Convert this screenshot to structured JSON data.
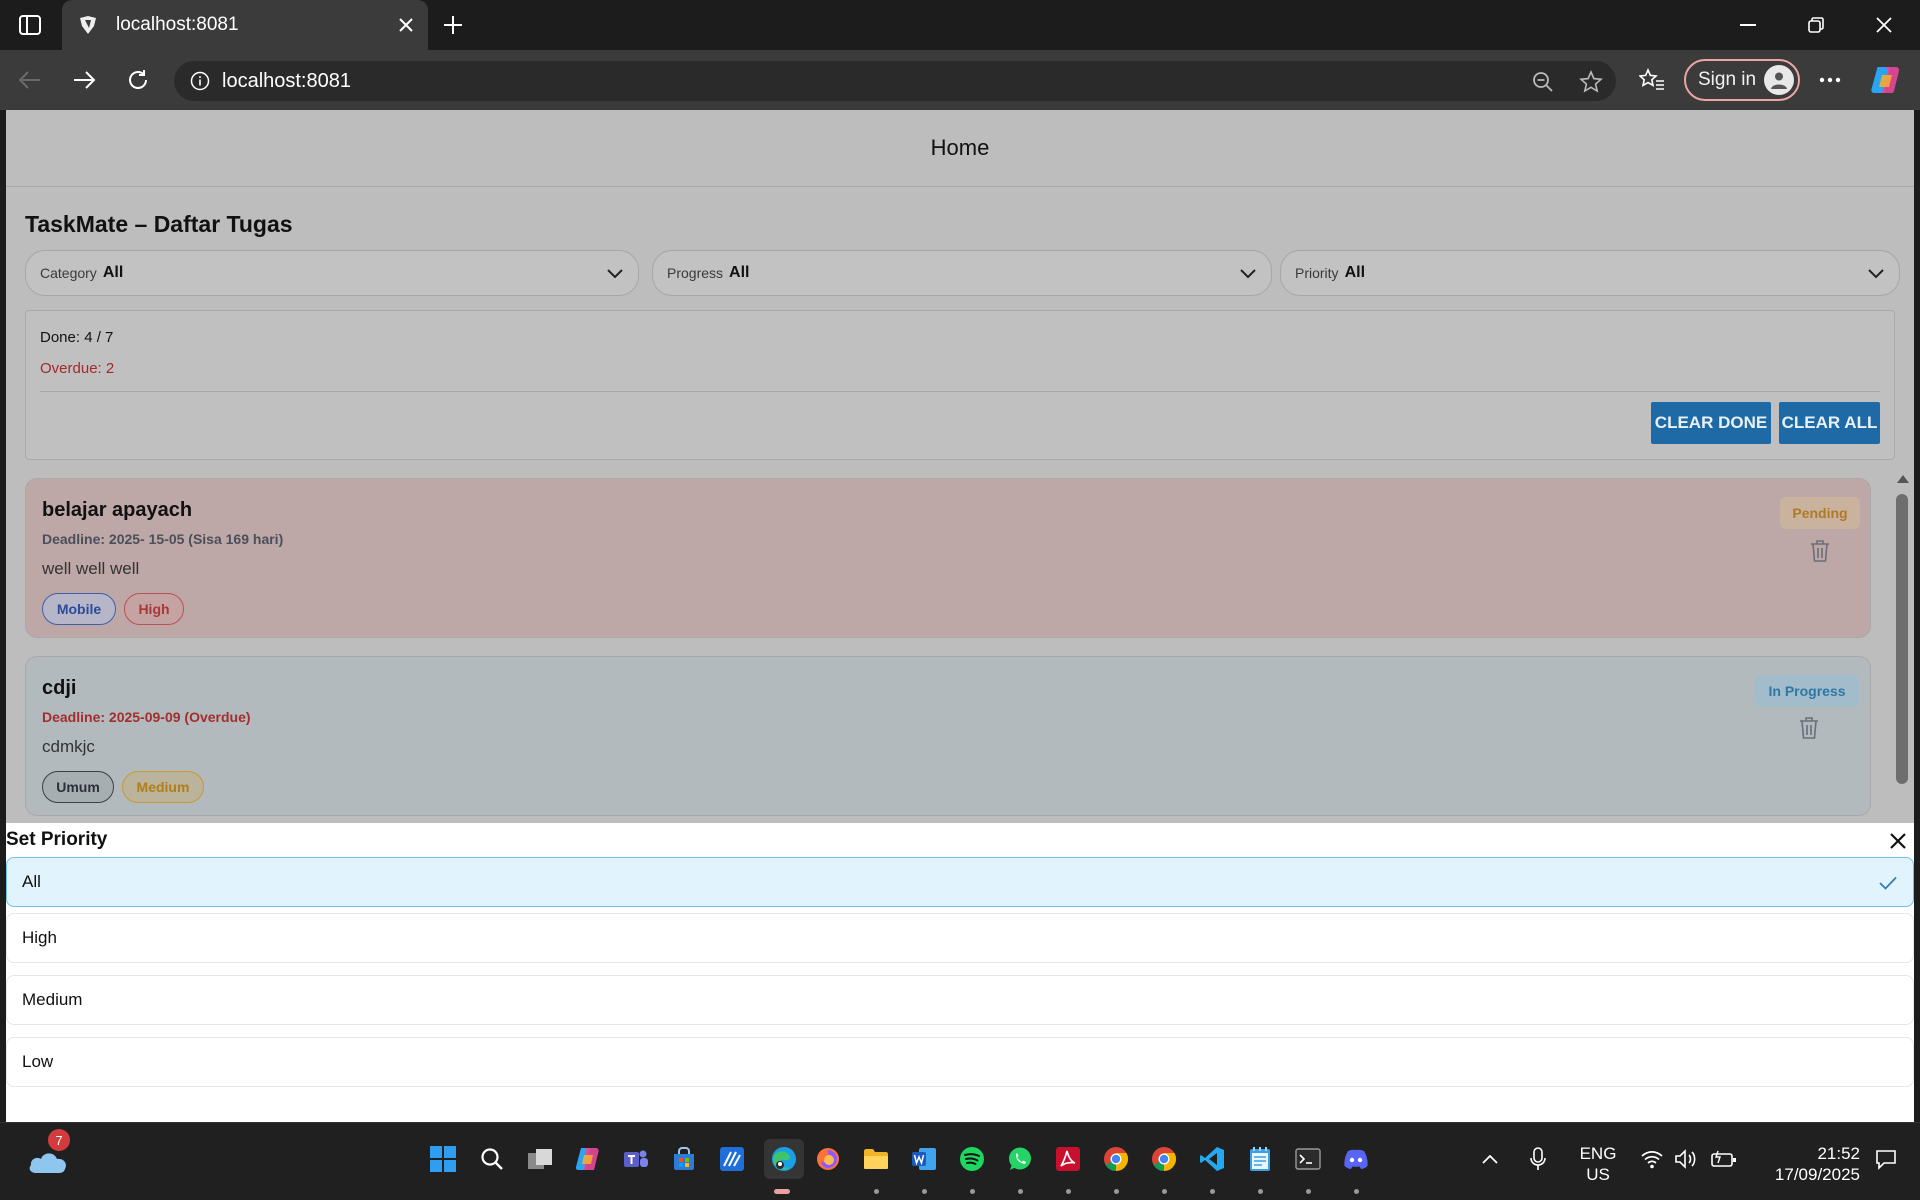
{
  "browser": {
    "tab_title": "localhost:8081",
    "url": "localhost:8081",
    "sign_in_label": "Sign in"
  },
  "app": {
    "appbar_title": "Home",
    "title": "TaskMate – Daftar Tugas",
    "filters": [
      {
        "label": "Category",
        "value": "All"
      },
      {
        "label": "Progress",
        "value": "All"
      },
      {
        "label": "Priority",
        "value": "All"
      }
    ],
    "summary": {
      "done": "Done: 4 / 7",
      "overdue": "Overdue: 2",
      "clear_done": "CLEAR DONE",
      "clear_all": "CLEAR ALL"
    },
    "tasks": [
      {
        "title": "belajar apayach",
        "deadline": "Deadline: 2025- 15-05 (Sisa 169 hari)",
        "description": "well well well",
        "tags": [
          "Mobile",
          "High"
        ],
        "status": "Pending"
      },
      {
        "title": "cdji",
        "deadline": "Deadline: 2025-09-09 (Overdue)",
        "description": "cdmkjc",
        "tags": [
          "Umum",
          "Medium"
        ],
        "status": "In Progress"
      }
    ]
  },
  "sheet": {
    "title": "Set Priority",
    "options": [
      "All",
      "High",
      "Medium",
      "Low"
    ],
    "selected": "All"
  },
  "taskbar": {
    "weather_badge": "7",
    "lang_line1": "ENG",
    "lang_line2": "US",
    "time": "21:52",
    "date": "17/09/2025"
  },
  "colors": {
    "accent_button": "#1e6aa6",
    "overdue_text": "#a22a2a",
    "selected_option_bg": "#e1f3fd"
  }
}
